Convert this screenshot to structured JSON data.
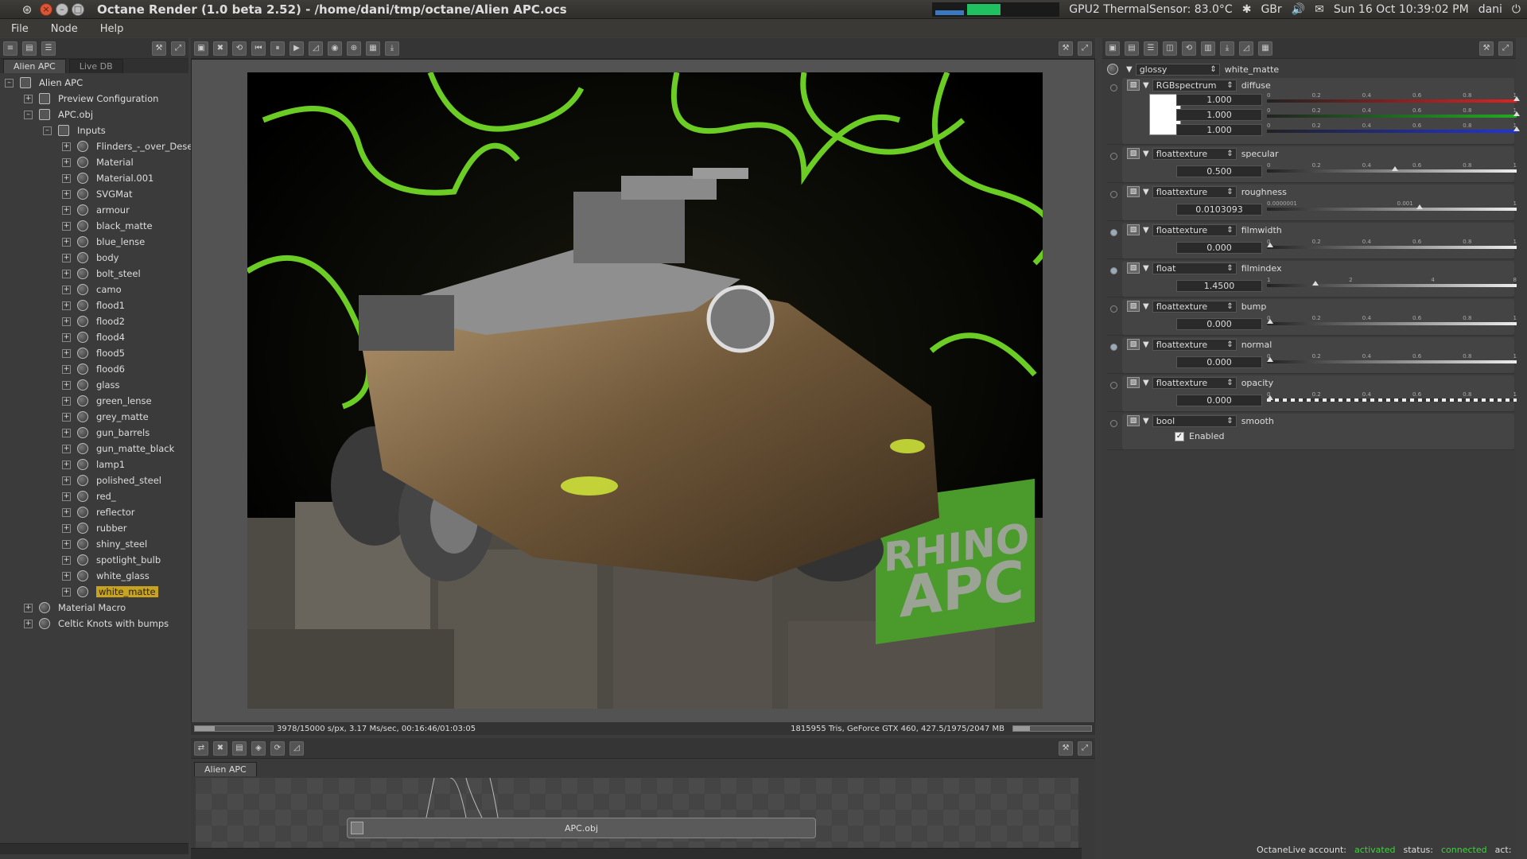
{
  "titlebar": {
    "title": "Octane Render (1.0 beta 2.52) - /home/dani/tmp/octane/Alien APC.ocs",
    "thermal": "GPU2 ThermalSensor: 83.0°C",
    "keyboard": "GBr",
    "datetime": "Sun 16 Oct 10:39:02 PM",
    "user": "dani"
  },
  "menu": {
    "file": "File",
    "node": "Node",
    "help": "Help"
  },
  "left": {
    "tabs": [
      "Alien APC",
      "Live DB"
    ],
    "tree_root": "Alien APC",
    "preview": "Preview Configuration",
    "obj": "APC.obj",
    "inputs": "Inputs",
    "materials": [
      "Flinders_-_over_Dese",
      "Material",
      "Material.001",
      "SVGMat",
      "armour",
      "black_matte",
      "blue_lense",
      "body",
      "bolt_steel",
      "camo",
      "flood1",
      "flood2",
      "flood4",
      "flood5",
      "flood6",
      "glass",
      "green_lense",
      "grey_matte",
      "gun_barrels",
      "gun_matte_black",
      "lamp1",
      "polished_steel",
      "red_",
      "reflector",
      "rubber",
      "shiny_steel",
      "spotlight_bulb",
      "white_glass",
      "white_matte"
    ],
    "macro": "Material Macro",
    "celtic": "Celtic Knots with bumps"
  },
  "render": {
    "status_left": "3978/15000 s/px, 3.17 Ms/sec, 00:16:46/01:03:05",
    "status_right": "1815955 Tris, GeForce GTX 460, 427.5/1975/2047 MB",
    "sign1": "RHINO",
    "sign2": "APC"
  },
  "nodegraph": {
    "tab": "Alien APC",
    "node_label": "APC.obj"
  },
  "inspector": {
    "type": "glossy",
    "name": "white_matte",
    "pins": [
      {
        "type": "RGBspectrum",
        "name": "diffuse",
        "vals": [
          "1.000",
          "1.000",
          "1.000"
        ]
      },
      {
        "type": "floattexture",
        "name": "specular",
        "val": "0.500",
        "pos": 0.5
      },
      {
        "type": "floattexture",
        "name": "roughness",
        "val": "0.0103093",
        "pos": 0.6
      },
      {
        "type": "floattexture",
        "name": "filmwidth",
        "val": "0.000",
        "pos": 0
      },
      {
        "type": "float",
        "name": "filmindex",
        "val": "1.4500",
        "pos": 0.18
      },
      {
        "type": "floattexture",
        "name": "bump",
        "val": "0.000",
        "pos": 0
      },
      {
        "type": "floattexture",
        "name": "normal",
        "val": "0.000",
        "pos": 0
      },
      {
        "type": "floattexture",
        "name": "opacity",
        "val": "0.000",
        "pos": 0
      },
      {
        "type": "bool",
        "name": "smooth",
        "val": "Enabled"
      }
    ],
    "ticks": [
      "0",
      "0.2",
      "0.4",
      "0.6",
      "0.8",
      "1"
    ],
    "rough_ticks": [
      "0.0000001",
      "0.001",
      "1"
    ],
    "index_ticks": [
      "1",
      "2",
      "4",
      "8"
    ]
  },
  "status": {
    "account_label": "OctaneLive account:",
    "account_value": "activated",
    "status_label": "status:",
    "status_value": "connected",
    "act_label": "act:"
  }
}
